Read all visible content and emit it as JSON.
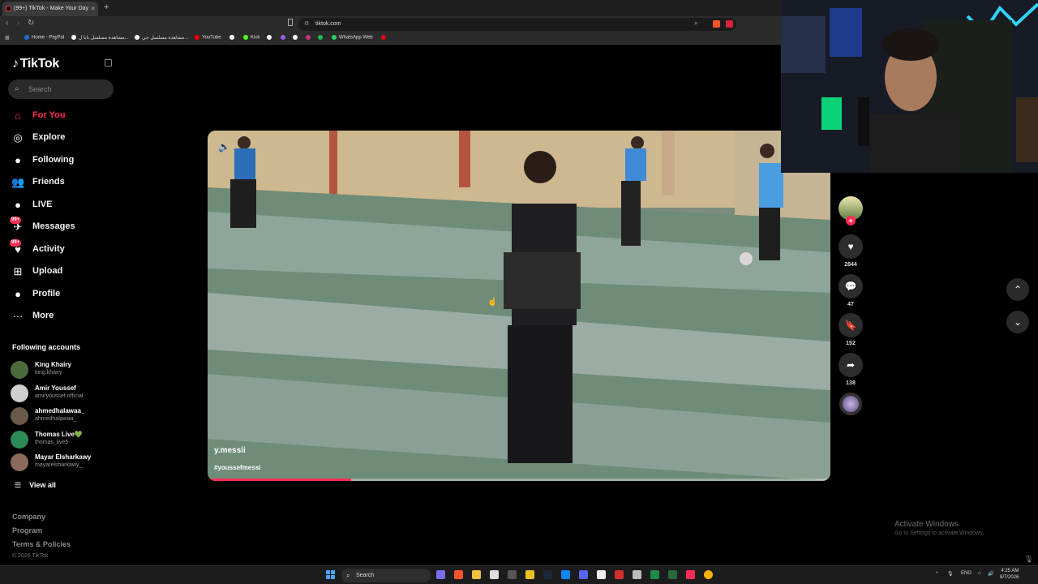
{
  "browser": {
    "tab_title": "(99+) TikTok - Make Your Day",
    "new_tab_symbol": "+",
    "tab_close_symbol": "×",
    "url": "tiktok.com",
    "bookmarks": [
      {
        "label": "Home - PayPal",
        "color": "#1e6fd8"
      },
      {
        "label": "مشاهدة مسلسل بابا ل...",
        "color": "#ffffff"
      },
      {
        "label": "مشاهدة مسلسل جي...",
        "color": "#ffffff"
      },
      {
        "label": "YouTube",
        "color": "#ff0000"
      },
      {
        "label": "",
        "color": "#ffffff"
      },
      {
        "label": "Kick",
        "color": "#53fc18"
      },
      {
        "label": "",
        "color": "#ffffff"
      },
      {
        "label": "",
        "color": "#9b5de5"
      },
      {
        "label": "",
        "color": "#ffffff"
      },
      {
        "label": "",
        "color": "#c13584"
      },
      {
        "label": "",
        "color": "#1db954"
      },
      {
        "label": "WhatsApp Web",
        "color": "#25d366"
      },
      {
        "label": "",
        "color": "#e50914"
      }
    ]
  },
  "sidebar": {
    "logo_text": "TikTok",
    "search_placeholder": "Search",
    "nav": [
      {
        "label": "For You",
        "icon": "home-icon",
        "glyph": "⌂",
        "active": true
      },
      {
        "label": "Explore",
        "icon": "compass-icon",
        "glyph": "◎"
      },
      {
        "label": "Following",
        "icon": "following-avatar-icon",
        "glyph": "●"
      },
      {
        "label": "Friends",
        "icon": "friends-icon",
        "glyph": "👥"
      },
      {
        "label": "LIVE",
        "icon": "live-avatar-icon",
        "glyph": "●"
      },
      {
        "label": "Messages",
        "icon": "message-icon",
        "glyph": "✈",
        "badge": "99+"
      },
      {
        "label": "Activity",
        "icon": "activity-icon",
        "glyph": "♥",
        "badge": "99+"
      },
      {
        "label": "Upload",
        "icon": "upload-icon",
        "glyph": "⊞"
      },
      {
        "label": "Profile",
        "icon": "profile-avatar-icon",
        "glyph": "●"
      },
      {
        "label": "More",
        "icon": "more-icon",
        "glyph": "···"
      }
    ],
    "following_heading": "Following accounts",
    "accounts": [
      {
        "name": "King Khairy",
        "handle": "king.khairy",
        "color": "#4c6b3c"
      },
      {
        "name": "Amir Youssef",
        "handle": "amiryoussef.official",
        "color": "#cfcfcf"
      },
      {
        "name": "ahmedhalawaa_",
        "handle": "ahmedhalawaa_",
        "color": "#6a5a4a"
      },
      {
        "name": "Thomas Live💚",
        "handle": "thomas_live5",
        "color": "#2e8b57"
      },
      {
        "name": "Mayar Elsharkawy",
        "handle": "mayarelsharkawy_",
        "color": "#8a6a5a"
      }
    ],
    "view_all": "View all",
    "footer": [
      "Company",
      "Program",
      "Terms & Policies"
    ],
    "copyright": "© 2026 TikTok"
  },
  "video": {
    "author": "y.messii",
    "hashtag": "#youssefmessi",
    "progress": 0.23
  },
  "actions": {
    "likes": "2844",
    "comments": "47",
    "saves": "152",
    "shares": "138"
  },
  "system": {
    "activate_title": "Activate Windows",
    "activate_sub": "Go to Settings to activate Windows.",
    "taskbar_search": "Search",
    "lang": "ENG",
    "time": "4:25 AM",
    "date": "8/7/2026"
  }
}
